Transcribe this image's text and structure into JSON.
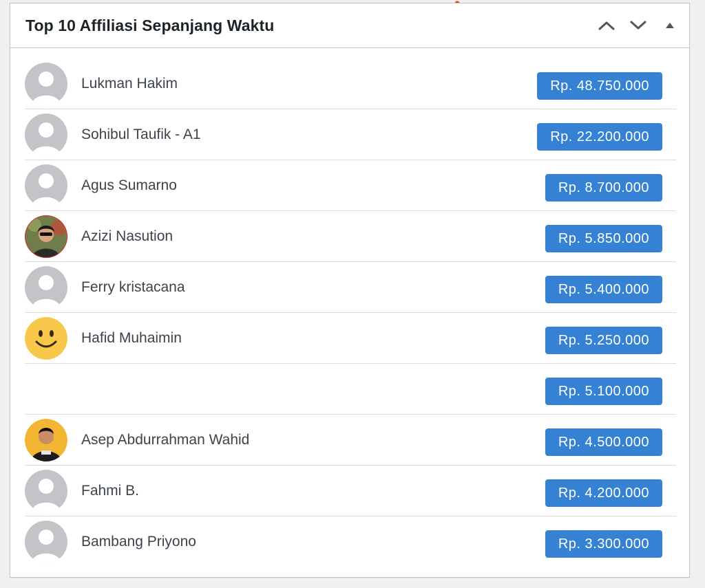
{
  "widget": {
    "title": "Top 10 Affiliasi Sepanjang Waktu",
    "controls": {
      "move_up_icon": "chevron-up-icon",
      "move_down_icon": "chevron-down-icon",
      "toggle_icon": "triangle-up-icon"
    }
  },
  "colors": {
    "badge": "#3582d4",
    "annotation_arrow": "#e8402a",
    "placeholder_avatar": "#c3c4c7"
  },
  "affiliates": [
    {
      "name": "Lukman Hakim",
      "amount": "Rp. 48.750.000",
      "avatar": "default-avatar"
    },
    {
      "name": "Sohibul Taufik - A1",
      "amount": "Rp. 22.200.000",
      "avatar": "default-avatar"
    },
    {
      "name": "Agus Sumarno",
      "amount": "Rp. 8.700.000",
      "avatar": "default-avatar"
    },
    {
      "name": "Azizi Nasution",
      "amount": "Rp. 5.850.000",
      "avatar": "photo-avatar"
    },
    {
      "name": "Ferry kristacana",
      "amount": "Rp. 5.400.000",
      "avatar": "default-avatar"
    },
    {
      "name": "Hafid Muhaimin",
      "amount": "Rp. 5.250.000",
      "avatar": "smiley-avatar"
    },
    {
      "name": "",
      "amount": "Rp. 5.100.000",
      "avatar": ""
    },
    {
      "name": "Asep Abdurrahman Wahid",
      "amount": "Rp. 4.500.000",
      "avatar": "photo-avatar"
    },
    {
      "name": "Fahmi B.",
      "amount": "Rp. 4.200.000",
      "avatar": "default-avatar"
    },
    {
      "name": "Bambang Priyono",
      "amount": "Rp. 3.300.000",
      "avatar": "default-avatar"
    }
  ]
}
